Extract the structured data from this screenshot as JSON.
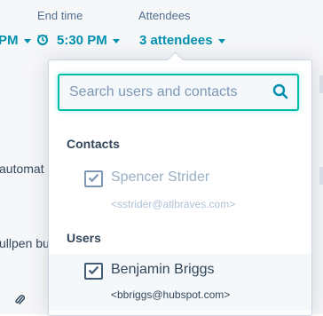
{
  "header": {
    "end_time_label": "End time",
    "attendees_label": "Attendees",
    "start_time_partial": "PM",
    "end_time_value": "5:30 PM",
    "attendees_value": "3 attendees"
  },
  "background": {
    "text_1": "automat",
    "text_2": "ullpen bu"
  },
  "dropdown": {
    "search": {
      "placeholder": "Search users and contacts",
      "value": ""
    },
    "sections": [
      {
        "title": "Contacts",
        "options": [
          {
            "name": "Spencer Strider",
            "email": "<sstrider@atlbraves.com>",
            "checked": true,
            "disabled": true
          }
        ]
      },
      {
        "title": "Users",
        "options": [
          {
            "name": "Benjamin Briggs",
            "email": "<bbriggs@hubspot.com>",
            "checked": true,
            "disabled": false
          }
        ]
      }
    ]
  },
  "colors": {
    "accent": "#0091ae",
    "focus": "#00bda5",
    "text": "#33475b"
  }
}
